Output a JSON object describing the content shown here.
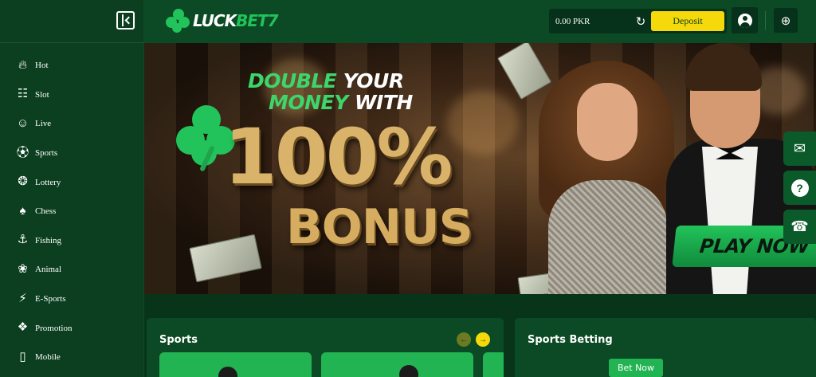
{
  "sidebar": {
    "items": [
      {
        "label": "Hot",
        "icon": "fire-icon"
      },
      {
        "label": "Slot",
        "icon": "slot-machine-icon"
      },
      {
        "label": "Live",
        "icon": "live-dealer-icon"
      },
      {
        "label": "Sports",
        "icon": "soccer-ball-icon"
      },
      {
        "label": "Lottery",
        "icon": "lottery-balls-icon"
      },
      {
        "label": "Chess",
        "icon": "cards-icon"
      },
      {
        "label": "Fishing",
        "icon": "fishing-icon"
      },
      {
        "label": "Animal",
        "icon": "rooster-icon"
      },
      {
        "label": "E-Sports",
        "icon": "lightning-icon"
      },
      {
        "label": "Promotion",
        "icon": "gift-bag-icon"
      },
      {
        "label": "Mobile",
        "icon": "mobile-icon"
      }
    ]
  },
  "header": {
    "logo_main": "LUCK",
    "logo_accent": "BET7",
    "balance": "0.00 PKR",
    "deposit_label": "Deposit"
  },
  "banner": {
    "line1_green": "DOUBLE",
    "line1_white": "YOUR",
    "line2_green": "MONEY",
    "line2_white": "WITH",
    "big_text": "100%",
    "bonus_text": "BONUS",
    "cta_label": "PLAY NOW"
  },
  "side_buttons": [
    "mail-icon",
    "help-icon",
    "support-chat-icon"
  ],
  "sections": {
    "sports_title": "Sports",
    "betting_title": "Sports Betting",
    "bet_now_label": "Bet Now"
  },
  "colors": {
    "brand_green": "#21c35a",
    "deposit_yellow": "#f5d90a",
    "sidebar_bg": "#0b3f20",
    "header_bg": "#0b4a24"
  }
}
